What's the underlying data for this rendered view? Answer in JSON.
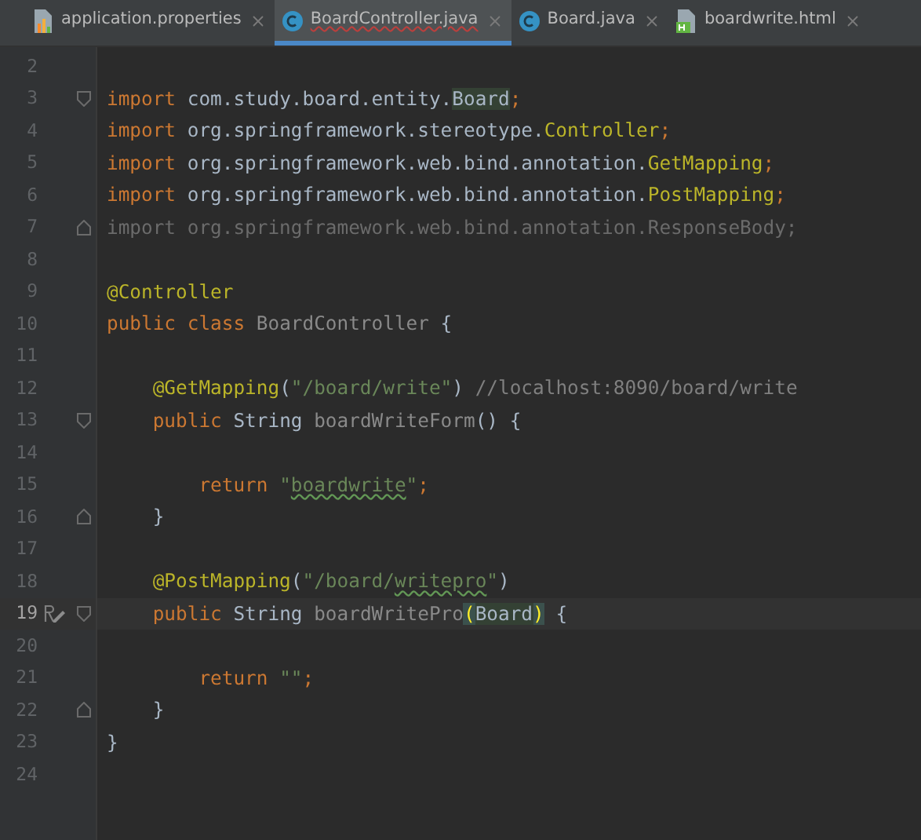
{
  "tabs": [
    {
      "label": "application.properties",
      "kind": "properties",
      "selected": false,
      "error": false
    },
    {
      "label": "BoardController.java",
      "kind": "class",
      "selected": true,
      "error": true
    },
    {
      "label": "Board.java",
      "kind": "class",
      "selected": false,
      "error": false
    },
    {
      "label": "boardwrite.html",
      "kind": "html",
      "selected": false,
      "error": false
    }
  ],
  "editor": {
    "lines": [
      {
        "number": "2",
        "current": false,
        "fold_start": false,
        "fold_end": false,
        "edit_mark": false
      },
      {
        "number": "3",
        "current": false,
        "fold_start": true,
        "fold_end": false,
        "edit_mark": false,
        "tokens": [
          {
            "kind": "keyword",
            "text": "import "
          },
          {
            "kind": "plain",
            "text": "com.study.board.entity."
          },
          {
            "kind": "highlight",
            "text": "Board"
          },
          {
            "kind": "keyword",
            "text": ";"
          }
        ]
      },
      {
        "number": "4",
        "current": false,
        "fold_start": false,
        "fold_end": false,
        "edit_mark": false,
        "tokens": [
          {
            "kind": "keyword",
            "text": "import "
          },
          {
            "kind": "plain",
            "text": "org.springframework.stereotype."
          },
          {
            "kind": "annotation",
            "text": "Controller"
          },
          {
            "kind": "keyword",
            "text": ";"
          }
        ]
      },
      {
        "number": "5",
        "current": false,
        "fold_start": false,
        "fold_end": false,
        "edit_mark": false,
        "tokens": [
          {
            "kind": "keyword",
            "text": "import "
          },
          {
            "kind": "plain",
            "text": "org.springframework.web.bind.annotation."
          },
          {
            "kind": "annotation",
            "text": "GetMapping"
          },
          {
            "kind": "keyword",
            "text": ";"
          }
        ]
      },
      {
        "number": "6",
        "current": false,
        "fold_start": false,
        "fold_end": false,
        "edit_mark": false,
        "tokens": [
          {
            "kind": "keyword",
            "text": "import "
          },
          {
            "kind": "plain",
            "text": "org.springframework.web.bind.annotation."
          },
          {
            "kind": "annotation",
            "text": "PostMapping"
          },
          {
            "kind": "keyword",
            "text": ";"
          }
        ]
      },
      {
        "number": "7",
        "current": false,
        "fold_start": false,
        "fold_end": true,
        "edit_mark": false,
        "tokens": [
          {
            "kind": "unused",
            "text": "import org.springframework.web.bind.annotation.ResponseBody;"
          }
        ]
      },
      {
        "number": "8",
        "current": false,
        "fold_start": false,
        "fold_end": false,
        "edit_mark": false
      },
      {
        "number": "9",
        "current": false,
        "fold_start": false,
        "fold_end": false,
        "edit_mark": false,
        "tokens": [
          {
            "kind": "annotation",
            "text": "@Controller"
          }
        ]
      },
      {
        "number": "10",
        "current": false,
        "fold_start": false,
        "fold_end": false,
        "edit_mark": false,
        "tokens": [
          {
            "kind": "keyword",
            "text": "public class "
          },
          {
            "kind": "unused_name",
            "text": "BoardController "
          },
          {
            "kind": "plain",
            "text": "{"
          }
        ]
      },
      {
        "number": "11",
        "current": false,
        "fold_start": false,
        "fold_end": false,
        "edit_mark": false
      },
      {
        "number": "12",
        "current": false,
        "fold_start": false,
        "fold_end": false,
        "edit_mark": false,
        "tokens": [
          {
            "kind": "annotation",
            "text": "    @GetMapping"
          },
          {
            "kind": "plain",
            "text": "("
          },
          {
            "kind": "string",
            "text": "\"/board/write\""
          },
          {
            "kind": "plain",
            "text": ") "
          },
          {
            "kind": "comment",
            "text": "//localhost:8090/board/write"
          }
        ]
      },
      {
        "number": "13",
        "current": false,
        "fold_start": true,
        "fold_end": false,
        "edit_mark": false,
        "tokens": [
          {
            "kind": "keyword",
            "text": "    public "
          },
          {
            "kind": "plain",
            "text": "String "
          },
          {
            "kind": "unused_name",
            "text": "boardWriteForm"
          },
          {
            "kind": "plain",
            "text": "() {"
          }
        ]
      },
      {
        "number": "14",
        "current": false,
        "fold_start": false,
        "fold_end": false,
        "edit_mark": false
      },
      {
        "number": "15",
        "current": false,
        "fold_start": false,
        "fold_end": false,
        "edit_mark": false,
        "tokens": [
          {
            "kind": "keyword",
            "text": "        return "
          },
          {
            "kind": "string",
            "text": "\""
          },
          {
            "kind": "typo_string",
            "text": "boardwrite"
          },
          {
            "kind": "string",
            "text": "\""
          },
          {
            "kind": "keyword",
            "text": ";"
          }
        ]
      },
      {
        "number": "16",
        "current": false,
        "fold_start": false,
        "fold_end": true,
        "edit_mark": false,
        "tokens": [
          {
            "kind": "plain",
            "text": "    }"
          }
        ]
      },
      {
        "number": "17",
        "current": false,
        "fold_start": false,
        "fold_end": false,
        "edit_mark": false
      },
      {
        "number": "18",
        "current": false,
        "fold_start": false,
        "fold_end": false,
        "edit_mark": false,
        "tokens": [
          {
            "kind": "annotation",
            "text": "    @PostMapping"
          },
          {
            "kind": "plain",
            "text": "("
          },
          {
            "kind": "string",
            "text": "\"/board/"
          },
          {
            "kind": "typo_string",
            "text": "writepro"
          },
          {
            "kind": "string",
            "text": "\""
          },
          {
            "kind": "plain",
            "text": ")"
          }
        ]
      },
      {
        "number": "19",
        "current": true,
        "fold_start": true,
        "fold_end": false,
        "edit_mark": true,
        "tokens": [
          {
            "kind": "keyword",
            "text": "    public "
          },
          {
            "kind": "plain",
            "text": "String "
          },
          {
            "kind": "unused_name",
            "text": "boardWritePro"
          },
          {
            "kind": "brace_match",
            "text": "("
          },
          {
            "kind": "highlight",
            "text": "Board"
          },
          {
            "kind": "brace_match",
            "text": ")"
          },
          {
            "kind": "plain",
            "text": " {"
          }
        ]
      },
      {
        "number": "20",
        "current": false,
        "fold_start": false,
        "fold_end": false,
        "edit_mark": false
      },
      {
        "number": "21",
        "current": false,
        "fold_start": false,
        "fold_end": false,
        "edit_mark": false,
        "tokens": [
          {
            "kind": "keyword",
            "text": "        return "
          },
          {
            "kind": "string",
            "text": "\"\""
          },
          {
            "kind": "keyword",
            "text": ";"
          }
        ]
      },
      {
        "number": "22",
        "current": false,
        "fold_start": false,
        "fold_end": true,
        "edit_mark": false,
        "tokens": [
          {
            "kind": "plain",
            "text": "    }"
          }
        ]
      },
      {
        "number": "23",
        "current": false,
        "fold_start": false,
        "fold_end": false,
        "edit_mark": false,
        "tokens": [
          {
            "kind": "plain",
            "text": "}"
          }
        ]
      },
      {
        "number": "24",
        "current": false,
        "fold_start": false,
        "fold_end": false,
        "edit_mark": false
      }
    ]
  }
}
